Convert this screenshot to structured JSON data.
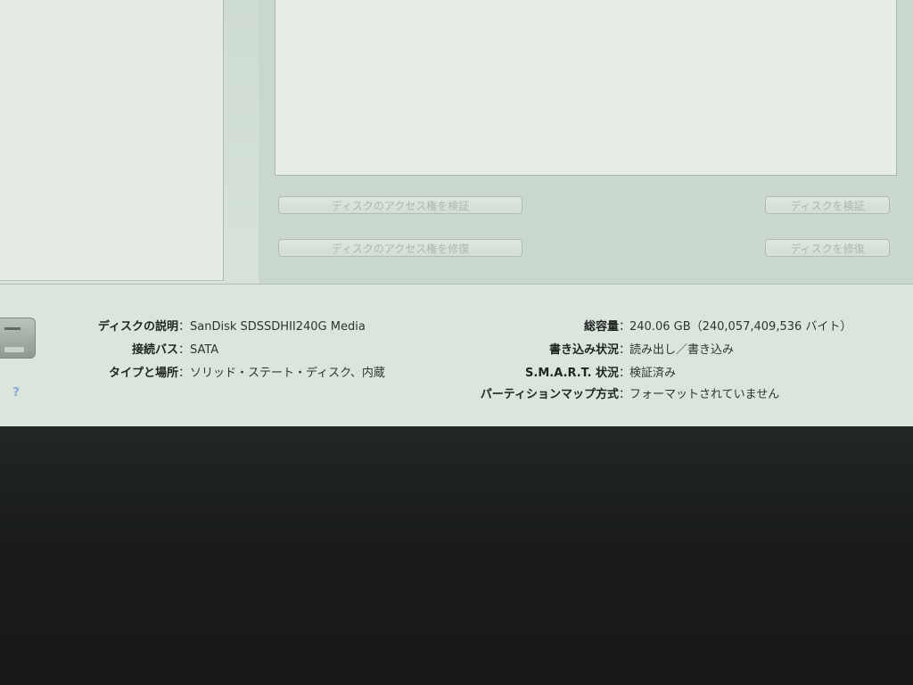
{
  "buttons": {
    "verify_permissions": "ディスクのアクセス権を検証",
    "repair_permissions": "ディスクのアクセス権を修復",
    "verify_disk": "ディスクを検証",
    "repair_disk": "ディスクを修復"
  },
  "help_symbol": "?",
  "separator": "：",
  "info": {
    "description_label": "ディスクの説明",
    "description_value": "SanDisk SDSSDHII240G Media",
    "bus_label": "接続バス",
    "bus_value": "SATA",
    "type_label": "タイプと場所",
    "type_value": "ソリッド・ステート・ディスク、内蔵",
    "capacity_label": "総容量",
    "capacity_value": "240.06 GB（240,057,409,536 バイト）",
    "write_label": "書き込み状況",
    "write_value": "読み出し／書き込み",
    "smart_label": "S.M.A.R.T. 状況",
    "smart_value": "検証済み",
    "partition_label": "パーティションマップ方式",
    "partition_value": "フォーマットされていません"
  },
  "icons": [
    "internal-disk-icon",
    "help-icon"
  ]
}
